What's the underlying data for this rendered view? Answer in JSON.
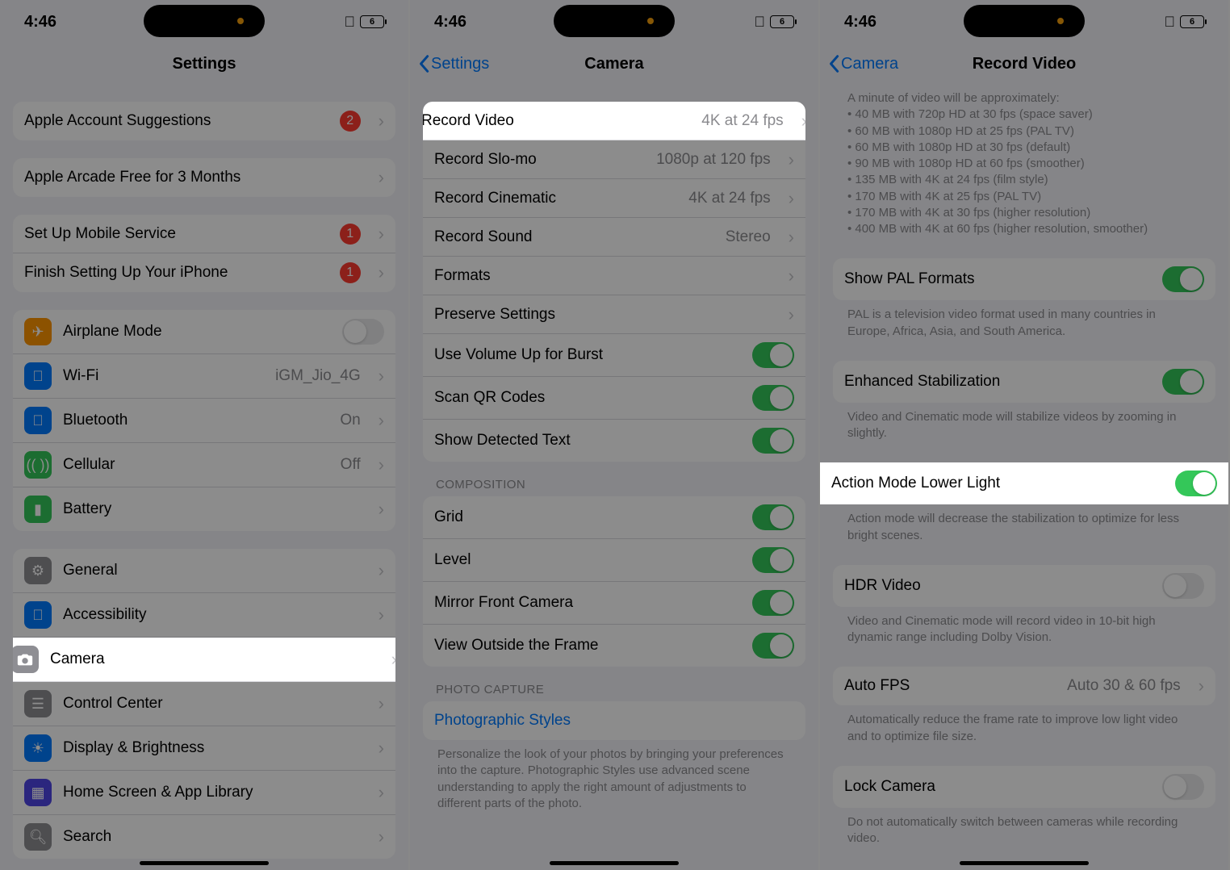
{
  "status": {
    "time": "4:46",
    "battery": "6"
  },
  "screen1": {
    "title": "Settings",
    "rows": {
      "apple_account": "Apple Account Suggestions",
      "apple_account_badge": "2",
      "arcade": "Apple Arcade Free for 3 Months",
      "mobile": "Set Up Mobile Service",
      "mobile_badge": "1",
      "finish": "Finish Setting Up Your iPhone",
      "finish_badge": "1",
      "airplane": "Airplane Mode",
      "wifi": "Wi-Fi",
      "wifi_val": "iGM_Jio_4G",
      "bluetooth": "Bluetooth",
      "bluetooth_val": "On",
      "cellular": "Cellular",
      "cellular_val": "Off",
      "battery": "Battery",
      "general": "General",
      "accessibility": "Accessibility",
      "camera": "Camera",
      "control": "Control Center",
      "display": "Display & Brightness",
      "home": "Home Screen & App Library",
      "search": "Search"
    }
  },
  "screen2": {
    "back": "Settings",
    "title": "Camera",
    "rows": {
      "record_video": "Record Video",
      "record_video_val": "4K at 24 fps",
      "slomo": "Record Slo-mo",
      "slomo_val": "1080p at 120 fps",
      "cinematic": "Record Cinematic",
      "cinematic_val": "4K at 24 fps",
      "sound": "Record Sound",
      "sound_val": "Stereo",
      "formats": "Formats",
      "preserve": "Preserve Settings",
      "burst": "Use Volume Up for Burst",
      "qr": "Scan QR Codes",
      "detected": "Show Detected Text"
    },
    "composition_header": "COMPOSITION",
    "composition": {
      "grid": "Grid",
      "level": "Level",
      "mirror": "Mirror Front Camera",
      "outside": "View Outside the Frame"
    },
    "photo_header": "PHOTO CAPTURE",
    "photo_styles": "Photographic Styles",
    "photo_footer": "Personalize the look of your photos by bringing your preferences into the capture. Photographic Styles use advanced scene understanding to apply the right amount of adjustments to different parts of the photo."
  },
  "screen3": {
    "back": "Camera",
    "title": "Record Video",
    "top_text": "A minute of video will be approximately:\n• 40 MB with 720p HD at 30 fps (space saver)\n• 60 MB with 1080p HD at 25 fps (PAL TV)\n• 60 MB with 1080p HD at 30 fps (default)\n• 90 MB with 1080p HD at 60 fps (smoother)\n• 135 MB with 4K at 24 fps (film style)\n• 170 MB with 4K at 25 fps (PAL TV)\n• 170 MB with 4K at 30 fps (higher resolution)\n• 400 MB with 4K at 60 fps (higher resolution, smoother)",
    "pal": "Show PAL Formats",
    "pal_footer": "PAL is a television video format used in many countries in Europe, Africa, Asia, and South America.",
    "stab": "Enhanced Stabilization",
    "stab_footer": "Video and Cinematic mode will stabilize videos by zooming in slightly.",
    "action": "Action Mode Lower Light",
    "action_footer": "Action mode will decrease the stabilization to optimize for less bright scenes.",
    "hdr": "HDR Video",
    "hdr_footer": "Video and Cinematic mode will record video in 10-bit high dynamic range including Dolby Vision.",
    "autofps": "Auto FPS",
    "autofps_val": "Auto 30 & 60 fps",
    "autofps_footer": "Automatically reduce the frame rate to improve low light video and to optimize file size.",
    "lock": "Lock Camera",
    "lock_footer": "Do not automatically switch between cameras while recording video."
  }
}
